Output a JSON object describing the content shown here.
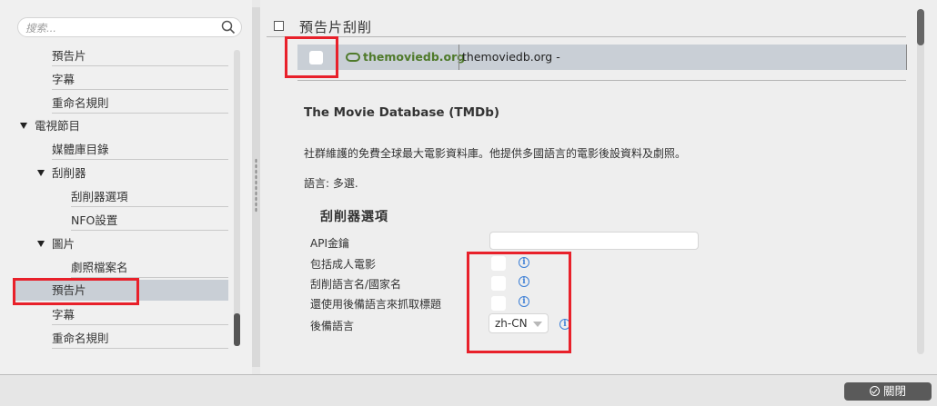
{
  "search": {
    "placeholder": "搜索..."
  },
  "tree": {
    "items": [
      {
        "label": "預告片"
      },
      {
        "label": "字幕"
      },
      {
        "label": "重命名規則"
      },
      {
        "label": "電視節目"
      },
      {
        "label": "媒體庫目錄"
      },
      {
        "label": "刮削器"
      },
      {
        "label": "刮削器選項"
      },
      {
        "label": "NFO設置"
      },
      {
        "label": "圖片"
      },
      {
        "label": "劇照檔案名"
      },
      {
        "label": "預告片"
      },
      {
        "label": "字幕"
      },
      {
        "label": "重命名規則"
      }
    ]
  },
  "main": {
    "section_title": "預告片刮削",
    "scraper_row": {
      "logo_text": "themoviedb.org",
      "text": "themoviedb.org -"
    },
    "heading": "The Movie Database (TMDb)",
    "description": "社群維護的免費全球最大電影資料庫。他提供多國語言的電影後設資料及劇照。",
    "language": "語言: 多選.",
    "options_title": "刮削器選項",
    "options": {
      "api_key_label": "API金鑰",
      "adult_label": "包括成人電影",
      "scrape_lang_label": "刮削語言名/國家名",
      "fallback_title_label": "還使用後備語言來抓取標題",
      "fallback_lang_label": "後備語言",
      "fallback_lang_value": "zh-CN"
    }
  },
  "footer": {
    "close_label": "關閉"
  },
  "colors": {
    "highlight": "#e8202a",
    "selected_row": "#c9cfd6",
    "info": "#3d7fd6",
    "tmdb_green": "#4f7a2b"
  }
}
